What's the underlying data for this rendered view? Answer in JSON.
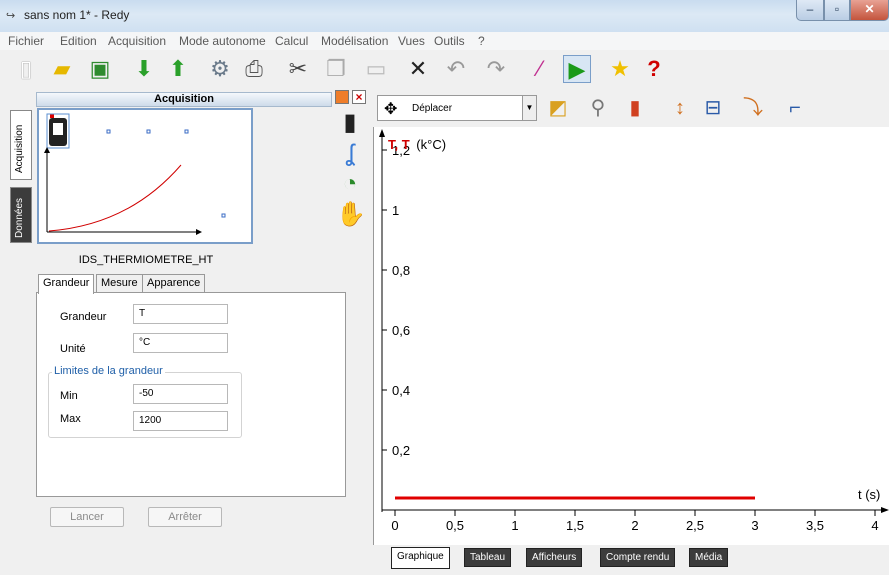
{
  "window": {
    "title": "sans nom 1* - Redy",
    "app_icon_glyph": "↪",
    "controls": {
      "minimize": "–",
      "maximize": "▫",
      "close": "✕"
    }
  },
  "menu": [
    "Fichier",
    "Edition",
    "Acquisition",
    "Mode autonome",
    "Calcul",
    "Modélisation",
    "Vues",
    "Outils",
    "?"
  ],
  "toolbar_icons": [
    "new-file-icon",
    "open-folder-icon",
    "save-icon",
    "import-icon",
    "export-icon",
    "share-icon",
    "print-icon",
    "cut-icon",
    "copy-icon",
    "paste-icon",
    "delete-icon",
    "undo-icon",
    "redo-icon",
    "wand-icon",
    "play-icon",
    "favorite-star-icon",
    "help-icon"
  ],
  "left_panel": {
    "vertical_tabs": {
      "acquisition": "Acquisition",
      "donnees": "Données"
    },
    "header": "Acquisition",
    "sensor_name": "IDS_THERMIOMETRE_HT",
    "tabs": [
      "Grandeur",
      "Mesure",
      "Apparence"
    ],
    "form": {
      "grandeur_label": "Grandeur",
      "grandeur_value": "T",
      "unite_label": "Unité",
      "unite_value": "°C",
      "group_title": "Limites de la grandeur",
      "min_label": "Min",
      "min_value": "-50",
      "max_label": "Max",
      "max_value": "1200"
    },
    "buttons": {
      "lancer": "Lancer",
      "arreter": "Arrêter"
    }
  },
  "graph": {
    "mode_label": "Déplacer",
    "colors": {
      "axis_title": "#d00000",
      "series": "#e00000"
    }
  },
  "chart_data": {
    "type": "line",
    "ylabel_highlight": "T, T",
    "ylabel_unit": "(k°C)",
    "xlabel": "t (s)",
    "ylim": [
      0,
      1.25
    ],
    "xlim": [
      0,
      4.1
    ],
    "yticks": [
      "0,2",
      "0,4",
      "0,6",
      "0,8",
      "1",
      "1,2"
    ],
    "ytick_values": [
      0.2,
      0.4,
      0.6,
      0.8,
      1,
      1.2
    ],
    "xticks": [
      "0",
      "0,5",
      "1",
      "1,5",
      "2",
      "2,5",
      "3",
      "3,5",
      "4"
    ],
    "xtick_values": [
      0,
      0.5,
      1,
      1.5,
      2,
      2.5,
      3,
      3.5,
      4
    ],
    "series": [
      {
        "x": [
          0,
          3
        ],
        "y": [
          0,
          0
        ]
      }
    ]
  },
  "bottom_tabs": [
    "Graphique",
    "Tableau",
    "Afficheurs",
    "Compte rendu",
    "Média"
  ]
}
